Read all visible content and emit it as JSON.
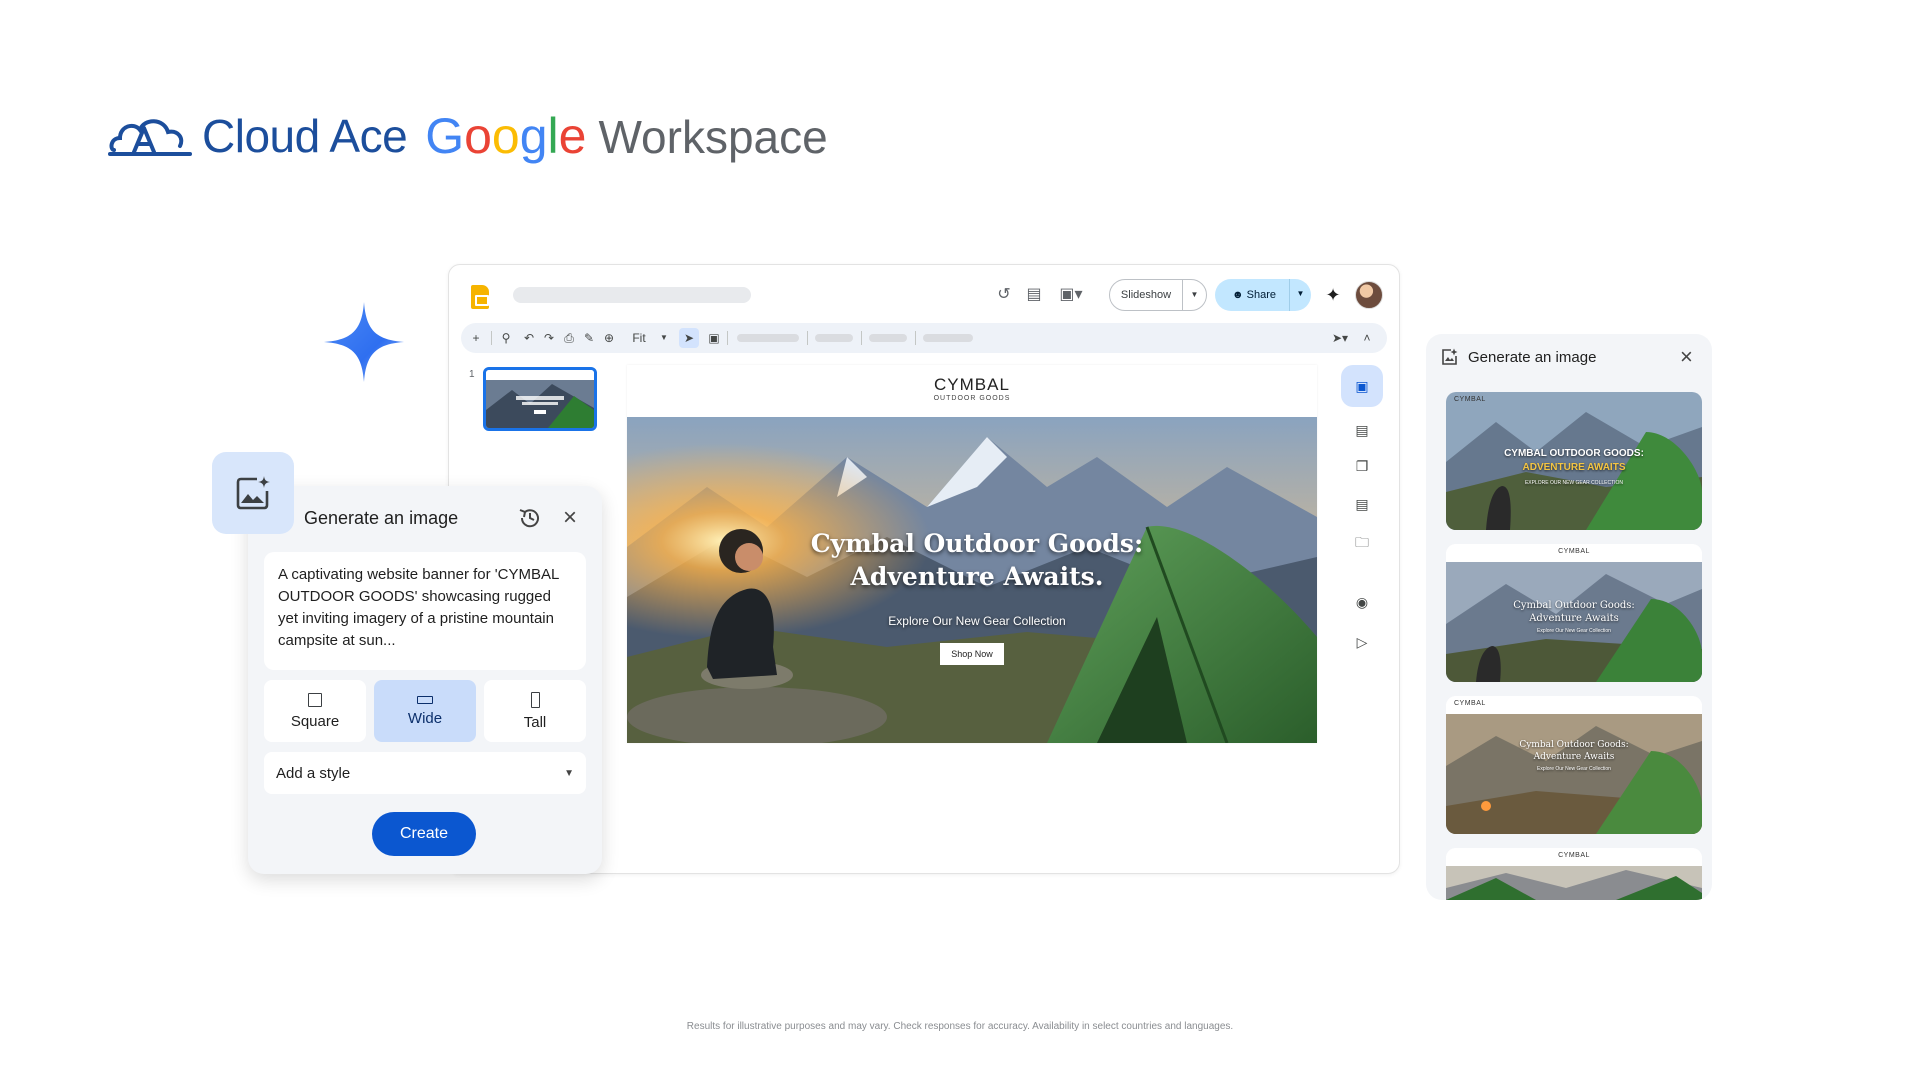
{
  "brand": {
    "cloud_ace": "Cloud Ace",
    "google_letters": [
      "G",
      "o",
      "o",
      "g",
      "l",
      "e"
    ],
    "workspace": "Workspace"
  },
  "slides_app": {
    "toolbar_buttons": {
      "slideshow": "Slideshow",
      "share": "Share",
      "fit": "Fit"
    },
    "slide_number": "1",
    "slide": {
      "brand": "CYMBAL",
      "brand_sub": "OUTDOOR GOODS",
      "headline_line1": "Cymbal Outdoor Goods:",
      "headline_line2": "Adventure Awaits.",
      "subhead": "Explore Our New Gear Collection",
      "cta": "Shop Now"
    }
  },
  "generate_card": {
    "title": "Generate an image",
    "prompt": "A captivating website banner for 'CYMBAL OUTDOOR GOODS' showcasing rugged yet inviting imagery of a pristine mountain campsite at sun...",
    "shapes": [
      {
        "label": "Square",
        "selected": false
      },
      {
        "label": "Wide",
        "selected": true
      },
      {
        "label": "Tall",
        "selected": false
      }
    ],
    "style_placeholder": "Add a style",
    "create_label": "Create"
  },
  "results_panel": {
    "title": "Generate an image",
    "results": [
      {
        "brand": "CYMBAL",
        "line1": "CYMBAL OUTDOOR GOODS:",
        "line2": "ADVENTURE AWAITS",
        "sub": "EXPLORE OUR NEW GEAR COLLECTION"
      },
      {
        "brand": "CYMBAL",
        "line1": "Cymbal Outdoor Goods:",
        "line2": "Adventure Awaits",
        "sub": "Explore Our New Gear Collection"
      },
      {
        "brand": "CYMBAL",
        "line1": "Cymbal Outdoor Goods:",
        "line2": "Adventure Awaits",
        "sub": "Explore Our New Gear Collection"
      },
      {
        "brand": "CYMBAL",
        "line1": "",
        "line2": "",
        "sub": ""
      }
    ]
  },
  "colors": {
    "google_blue": "#4285f4",
    "google_red": "#ea4335",
    "google_yellow": "#fbbc04",
    "google_green": "#34a853",
    "cloud_ace_blue": "#1c4e9c",
    "accent": "#0b57d0"
  },
  "icons": [
    "cloud-ace-logo",
    "gemini-sparkle-icon",
    "slides-logo",
    "history-icon",
    "comment-icon",
    "camera-icon",
    "people-icon",
    "sparkle-icon",
    "add-icon",
    "search-icon",
    "undo-icon",
    "redo-icon",
    "print-icon",
    "paint-format-icon",
    "zoom-icon",
    "cursor-icon",
    "textbox-icon",
    "pen-icon",
    "chevron-up-icon",
    "generate-image-icon",
    "close-icon",
    "square-icon",
    "wide-icon",
    "tall-icon",
    "dropdown-caret-icon"
  ],
  "disclaimer": "Results for illustrative purposes and may vary. Check responses for accuracy. Availability in select countries and languages."
}
